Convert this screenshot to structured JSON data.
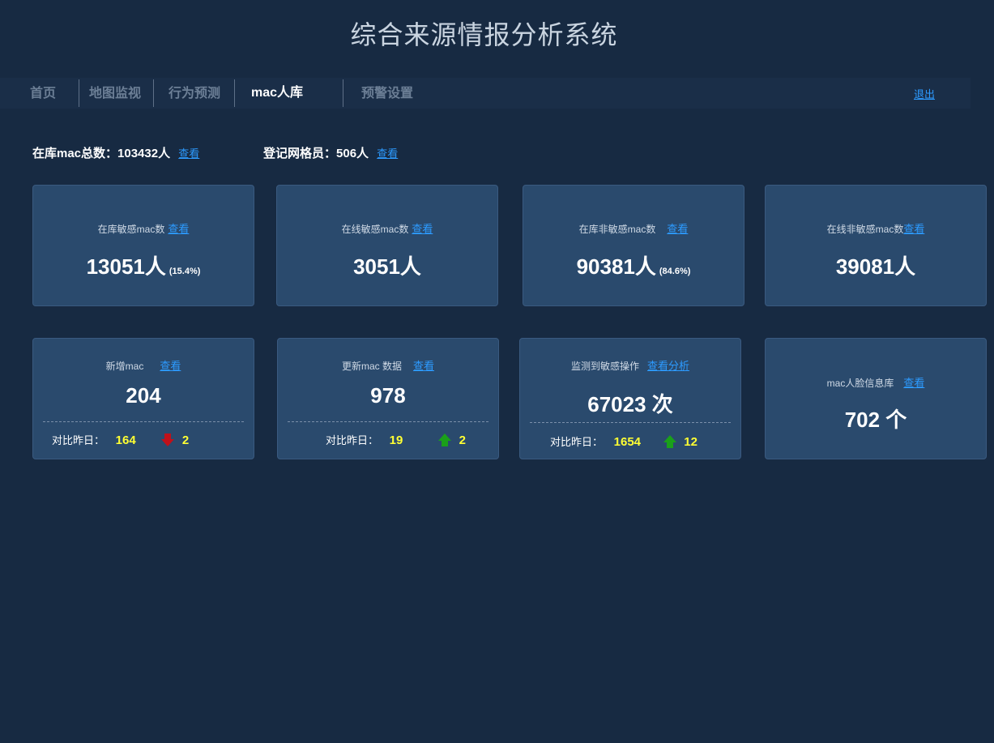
{
  "app": {
    "title": "综合来源情报分析系统"
  },
  "nav": {
    "tabs": [
      {
        "label": "首页"
      },
      {
        "label": "地图监视"
      },
      {
        "label": "行为预测"
      },
      {
        "label": "mac人库"
      },
      {
        "label": "预警设置"
      }
    ],
    "active_tab": "mac人库",
    "logout": "退出"
  },
  "summary": {
    "mac_total_label": "在库mac总数：",
    "mac_total_value": "103432人",
    "grid_staff_label": "登记网格员：",
    "grid_staff_value": "506人",
    "view": "查看"
  },
  "stats_row1": [
    {
      "label": "在库敏感mac数",
      "link": "查看",
      "value": "13051人",
      "pct": "(15.4%)"
    },
    {
      "label": "在线敏感mac数",
      "link": "查看",
      "value": "3051人",
      "pct": ""
    },
    {
      "label": "在库非敏感mac数",
      "link": "查看",
      "value": "90381人",
      "pct": "(84.6%)"
    },
    {
      "label": "在线非敏感mac数",
      "link": "查看",
      "value": "39081人",
      "pct": ""
    }
  ],
  "stats_row2": [
    {
      "label": "新增mac",
      "link": "查看",
      "value": "204",
      "compare_label": "对比昨日：",
      "compare_value": "164",
      "delta": "2",
      "trend": "down"
    },
    {
      "label": "更新mac 数据",
      "link": "查看",
      "value": "978",
      "compare_label": "对比昨日：",
      "compare_value": "19",
      "delta": "2",
      "trend": "up"
    },
    {
      "label": "监测到敏感操作",
      "link": "查看分析",
      "value": "67023 次",
      "compare_label": "对比昨日：",
      "compare_value": "1654",
      "delta": "12",
      "trend": "up"
    },
    {
      "label": "mac人脸信息库",
      "link": "查看",
      "value": "702 个"
    }
  ],
  "colors": {
    "background": "#172a42",
    "card": "#2a4a6d",
    "link": "#2d9bff",
    "highlight": "#ffff33",
    "trend_down": "#c0111a",
    "trend_up": "#1aa01a"
  }
}
